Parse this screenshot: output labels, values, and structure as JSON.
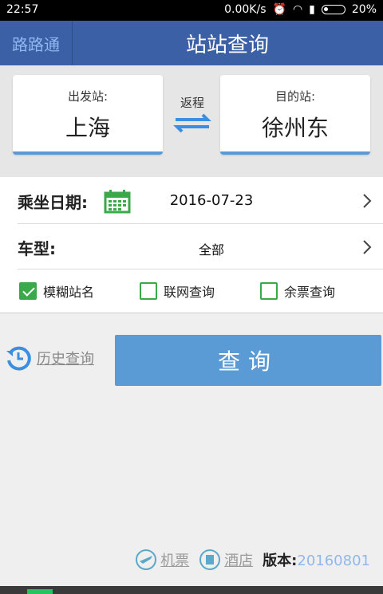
{
  "status": {
    "time": "22:57",
    "network_speed": "0.00K/s",
    "battery": "20%"
  },
  "header": {
    "back_label": "路路通",
    "title": "站站查询"
  },
  "stations": {
    "from_label": "出发站:",
    "from_value": "上海",
    "swap_label": "返程",
    "to_label": "目的站:",
    "to_value": "徐州东"
  },
  "form": {
    "date_label": "乘坐日期:",
    "date_value": "2016-07-23",
    "type_label": "车型:",
    "type_value": "全部"
  },
  "options": [
    {
      "label": "模糊站名",
      "checked": true
    },
    {
      "label": "联网查询",
      "checked": false
    },
    {
      "label": "余票查询",
      "checked": false
    }
  ],
  "actions": {
    "history_label": "历史查询",
    "query_label": "查询"
  },
  "footer": {
    "flights_label": "机票",
    "hotels_label": "酒店",
    "version_label": "版本:",
    "version_number": "20160801"
  },
  "colors": {
    "header": "#3b60a6",
    "accent": "#5b9bd5",
    "check": "#3aa94a"
  }
}
